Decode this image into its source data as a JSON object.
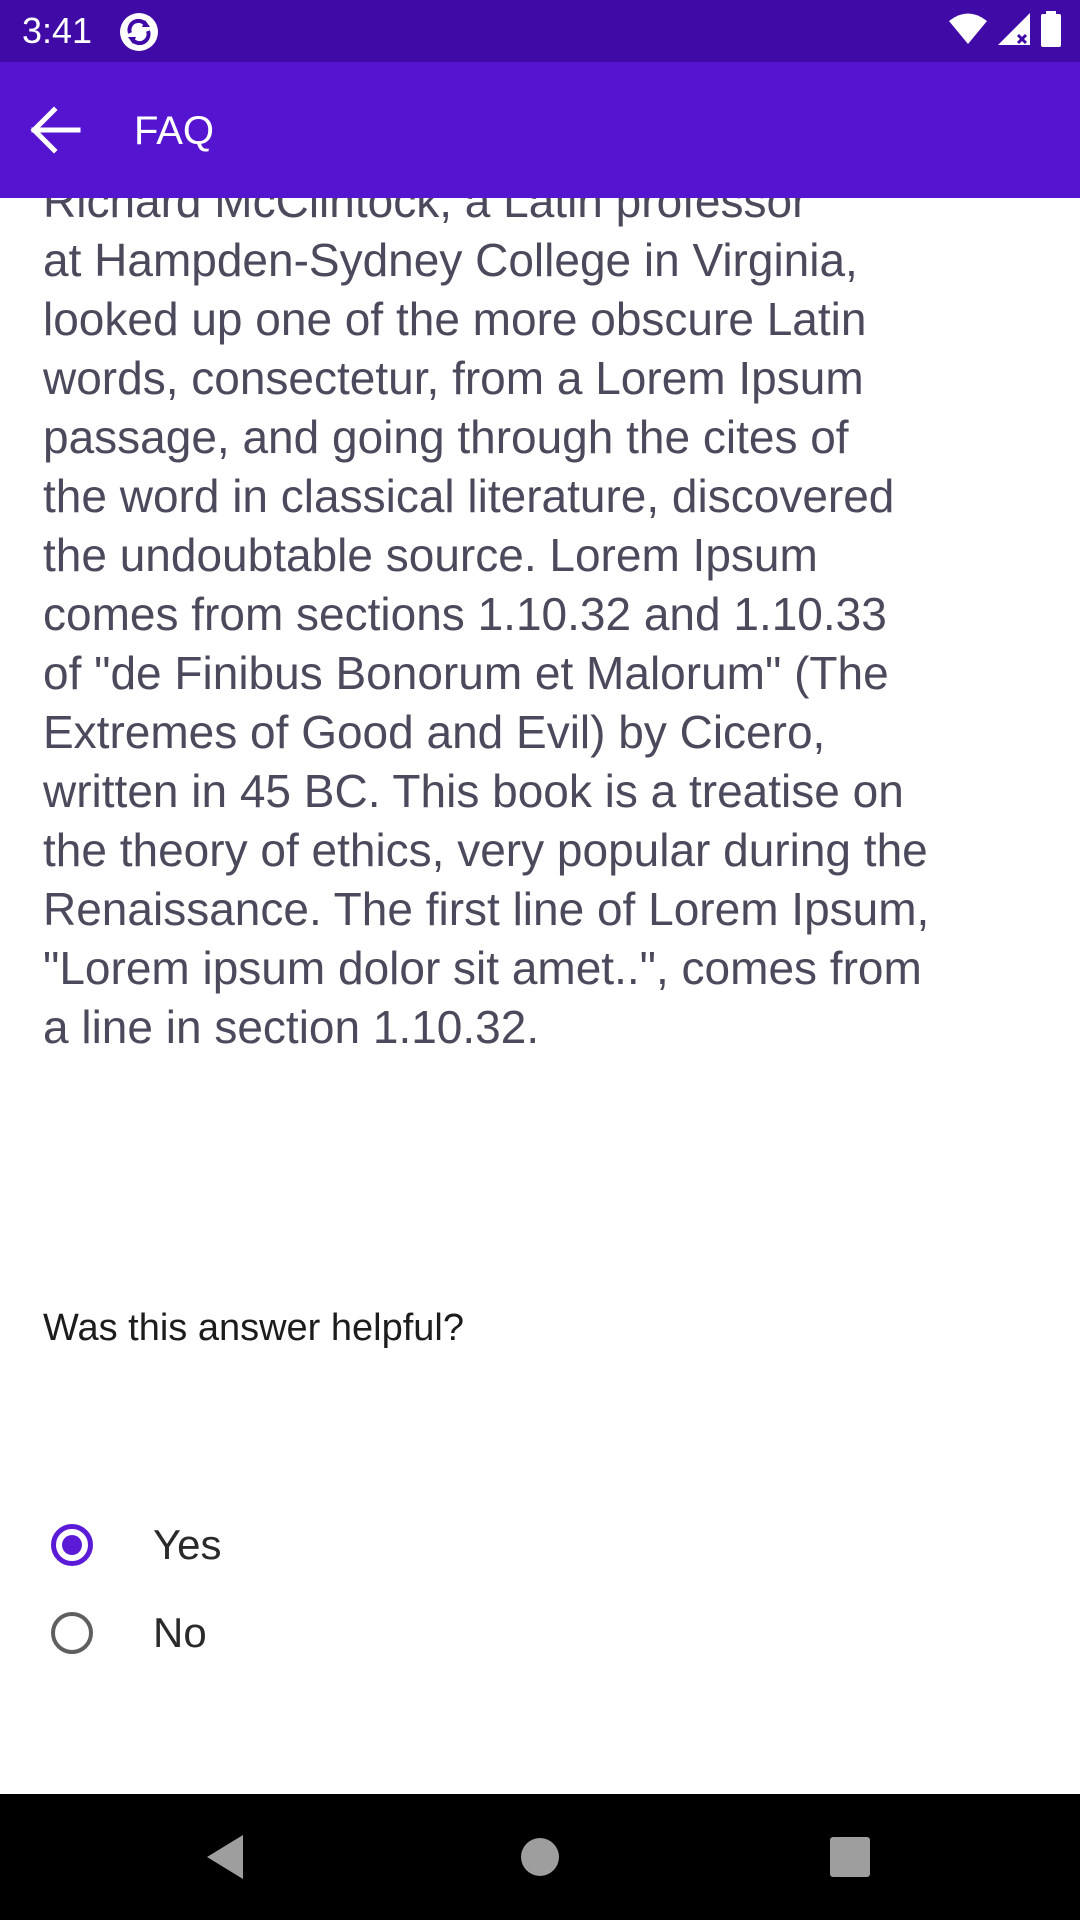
{
  "status_bar": {
    "time": "3:41",
    "icons": [
      "sync-app-icon",
      "wifi-icon",
      "cellular-signal-icon",
      "battery-icon"
    ]
  },
  "app_bar": {
    "title": "FAQ",
    "back_icon": "arrow-left-icon"
  },
  "answer": {
    "text": "Richard McClintock, a Latin professor\nat Hampden-Sydney College in Virginia,\nlooked up one of the more obscure Latin\nwords, consectetur, from a Lorem Ipsum\npassage, and going through the cites of\nthe word in classical literature, discovered\nthe undoubtable source. Lorem Ipsum\ncomes from sections 1.10.32 and 1.10.33\nof \"de Finibus Bonorum et Malorum\" (The\nExtremes of Good and Evil) by Cicero,\nwritten in 45 BC. This book is a treatise on\nthe theory of ethics, very popular during the\nRenaissance. The first line of Lorem Ipsum,\n\"Lorem ipsum dolor sit amet..\", comes from\na line in section 1.10.32."
  },
  "feedback": {
    "question": "Was this answer helpful?",
    "options": [
      {
        "label": "Yes",
        "selected": true
      },
      {
        "label": "No",
        "selected": false
      }
    ]
  },
  "nav_bar": {
    "icons": [
      "nav-back-icon",
      "nav-home-icon",
      "nav-recents-icon"
    ]
  },
  "colors": {
    "status_bar": "#3f0aa6",
    "app_bar": "#5515d0",
    "accent": "#5b1bd6",
    "text": "#4a4a5c"
  }
}
